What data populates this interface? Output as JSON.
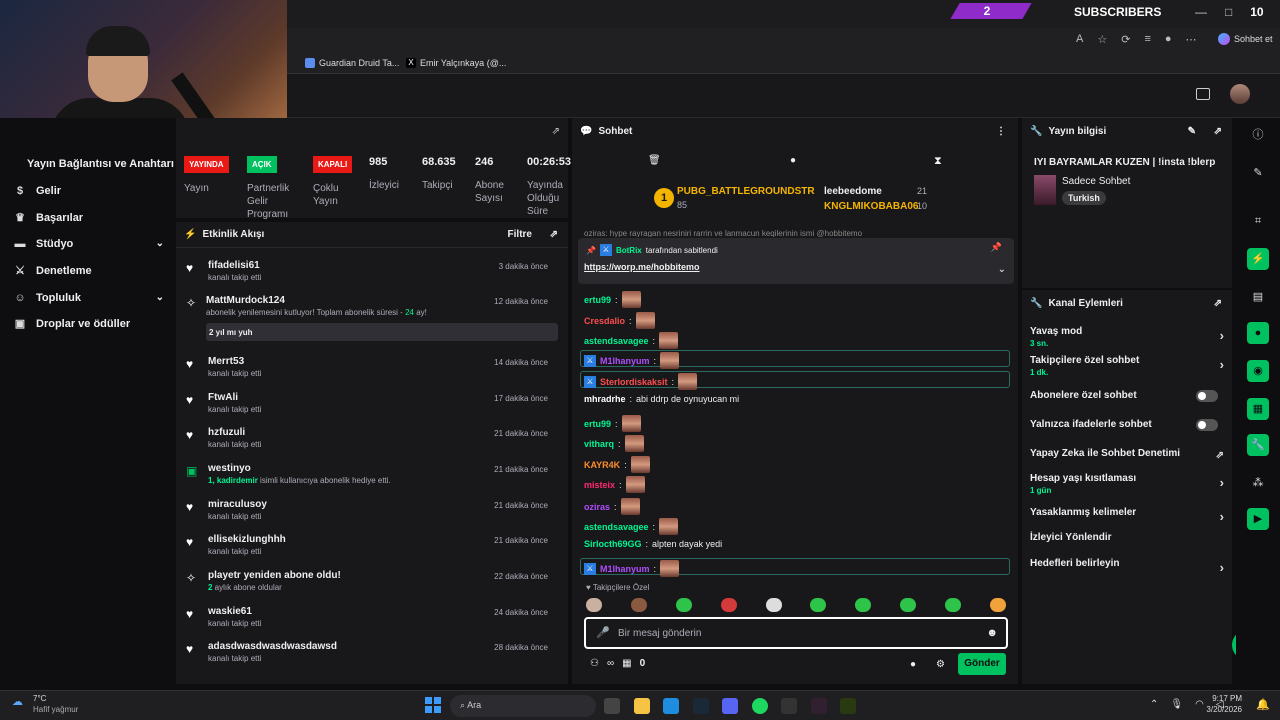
{
  "overlay": {
    "sub_count": "2",
    "sub_label": "SUBSCRIBERS",
    "win_num": "10",
    "window_ctrls": [
      "—",
      "□",
      "✕"
    ]
  },
  "browser": {
    "profile": "Sohbet et",
    "bookmarks": [
      "Guardian Druid Ta...",
      "Emir Yalçınkaya (@..."
    ]
  },
  "sidebar": {
    "connection": "Yayın Bağlantısı ve Anahtarı",
    "items": [
      {
        "label": "Gelir",
        "icon": "dollar-icon"
      },
      {
        "label": "Başarılar",
        "icon": "trophy-icon"
      },
      {
        "label": "Stüdyo",
        "icon": "video-icon",
        "chevron": true
      },
      {
        "label": "Denetleme",
        "icon": "sword-icon"
      },
      {
        "label": "Topluluk",
        "icon": "people-icon",
        "chevron": true
      },
      {
        "label": "Droplar ve ödüller",
        "icon": "gift-icon"
      }
    ]
  },
  "stats": {
    "items": [
      {
        "badge": "YAYINDA",
        "badge_color": "#e91916",
        "label": "Yayın"
      },
      {
        "badge": "AÇIK",
        "badge_color": "#00c15f",
        "label": "Partnerlik Gelir Programı"
      },
      {
        "badge": "KAPALI",
        "badge_color": "#e91916",
        "label": "Çoklu Yayın"
      },
      {
        "value": "985",
        "label": "İzleyici"
      },
      {
        "value": "68.635",
        "label": "Takipçi"
      },
      {
        "value": "246",
        "label": "Abone Sayısı"
      },
      {
        "value": "00:26:53",
        "label": "Yayında Olduğu Süre"
      }
    ]
  },
  "activity": {
    "title": "Etkinlik Akışı",
    "filter": "Filtre",
    "items": [
      {
        "icon": "heart-icon",
        "name": "fifadelisi61",
        "sub": "kanalı takip etti",
        "time": "3 dakika önce"
      },
      {
        "icon": "star-icon",
        "name": "MattMurdock124",
        "sub": "abonelik yenilemesini kutluyor! Toplam abonelik süresi - ",
        "sub_hl": "24",
        "sub_end": " ay!",
        "msg": "2 yıl mı yuh",
        "time": "12 dakika önce"
      },
      {
        "icon": "heart-icon",
        "name": "Merrt53",
        "sub": "kanalı takip etti",
        "time": "14 dakika önce"
      },
      {
        "icon": "heart-icon",
        "name": "FtwAli",
        "sub": "kanalı takip etti",
        "time": "17 dakika önce"
      },
      {
        "icon": "heart-icon",
        "name": "hzfuzuli",
        "sub": "kanalı takip etti",
        "time": "21 dakika önce"
      },
      {
        "icon": "gift-icon",
        "name": "westinyo",
        "sub_hl": "1, kadirdemir",
        "sub": " isimli kullanıcıya abonelik hediye etti.",
        "time": "21 dakika önce"
      },
      {
        "icon": "heart-icon",
        "name": "miraculusoy",
        "sub": "kanalı takip etti",
        "time": "21 dakika önce"
      },
      {
        "icon": "heart-icon",
        "name": "ellisekizlunghhh",
        "sub": "kanalı takip etti",
        "time": "21 dakika önce"
      },
      {
        "icon": "star-icon",
        "name": "playetr yeniden abone oldu!",
        "sub_hl": "2",
        "sub": " aylık abone oldular",
        "time": "22 dakika önce"
      },
      {
        "icon": "heart-icon",
        "name": "waskie61",
        "sub": "kanalı takip etti",
        "time": "24 dakika önce"
      },
      {
        "icon": "heart-icon",
        "name": "adasdwasdwasdwasdawsd",
        "sub": "kanalı takip etti",
        "time": "28 dakika önce"
      }
    ]
  },
  "chat": {
    "title": "Sohbet",
    "top_chatter": {
      "rank": "1",
      "name": "PUBG_BATTLEGROUNDSTR",
      "count": "85"
    },
    "chatter2": {
      "name": "leebeedome",
      "count": "21"
    },
    "chatter3": {
      "name": "KNGLMIKOBABA06",
      "count": "10"
    },
    "clipped": "oziras: hype rayragan nesriniri rarrin ve lanmacun keqilerinin ismi @hobbitemo",
    "pinned_by": "tarafından sabitlendi",
    "pinned_user": "BotRix",
    "pinned_link": "https://worp.me/hobbitemo",
    "messages": [
      {
        "user": "ertu99",
        "color": "#00f593"
      },
      {
        "user": "Cresdalio",
        "color": "#ff4d4d"
      },
      {
        "user": "astendsavagee",
        "color": "#00f593"
      },
      {
        "user": "M1lhanyum",
        "color": "#b04dff",
        "hl": true
      },
      {
        "user": "Sterlordiskaksit",
        "color": "#ff4d4d",
        "hl": true
      },
      {
        "user": "mhradrhe",
        "color": "#ffffff",
        "text": "abi ddrp de oynuyucan mi"
      },
      {
        "user": "ertu99",
        "color": "#00f593"
      },
      {
        "user": "vitharq",
        "color": "#00f593"
      },
      {
        "user": "KAYR4K",
        "color": "#ff8c2a"
      },
      {
        "user": "misteix",
        "color": "#ff2a6d"
      },
      {
        "user": "oziras",
        "color": "#b04dff"
      },
      {
        "user": "astendsavagee",
        "color": "#00f593"
      },
      {
        "user": "Sirlocth69GG",
        "color": "#00f593",
        "text": "alpten dayak yedi"
      },
      {
        "user": "M1lhanyum",
        "color": "#b04dff",
        "hl": true
      }
    ],
    "followers_only": "Takipçilere Özel",
    "placeholder": "Bir mesaj gönderin",
    "points": "0",
    "send": "Gönder"
  },
  "stream_info": {
    "title": "Yayın bilgisi",
    "stream_title": "IYI BAYRAMLAR KUZEN | !insta !blerp",
    "category": "Sadece Sohbet",
    "tag": "Turkish"
  },
  "channel_actions": {
    "title": "Kanal Eylemleri",
    "items": [
      {
        "label": "Yavaş mod",
        "value": "3 sn.",
        "type": "arrow"
      },
      {
        "label": "Takipçilere özel sohbet",
        "value": "1 dk.",
        "type": "arrow"
      },
      {
        "label": "Abonelere özel sohbet",
        "type": "toggle"
      },
      {
        "label": "Yalnızca ifadelerle sohbet",
        "type": "toggle"
      },
      {
        "label": "Yapay Zeka ile Sohbet Denetimi",
        "type": "ext"
      },
      {
        "label": "Hesap yaşı kısıtlaması",
        "value": "1 gün",
        "type": "arrow"
      },
      {
        "label": "Yasaklanmış kelimeler",
        "type": "arrow"
      },
      {
        "label": "İzleyici Yönlendir",
        "type": "none"
      },
      {
        "label": "Hedefleri belirleyin",
        "type": "arrow"
      }
    ]
  },
  "taskbar": {
    "temp": "7°C",
    "weather": "Hafif yağmur",
    "search": "Ara",
    "time": "9:17 PM",
    "date": "3/20/2026"
  }
}
